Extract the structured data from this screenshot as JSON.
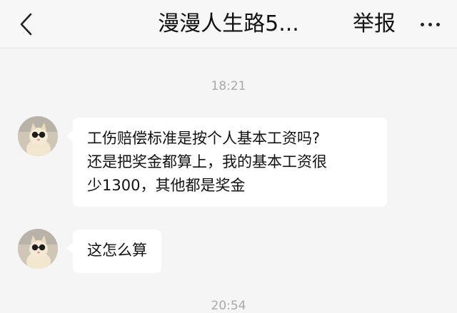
{
  "header": {
    "title": "漫漫人生路5...",
    "report_label": "举报"
  },
  "messages": [
    {
      "time": "18:21",
      "lines": [
        "工伤赔偿标准是按个人基本工资吗?",
        "还是把奖金都算上，我的基本工资很",
        "少1300，其他都是奖金"
      ]
    },
    {
      "text": "这怎么算"
    }
  ],
  "next_time": "20:54",
  "icons": {
    "back": "chevron-left-icon",
    "more": "more-horizontal-icon"
  },
  "colors": {
    "background": "#f5f5f5",
    "bubble": "#ffffff",
    "timestamp": "#a9a9a9"
  }
}
